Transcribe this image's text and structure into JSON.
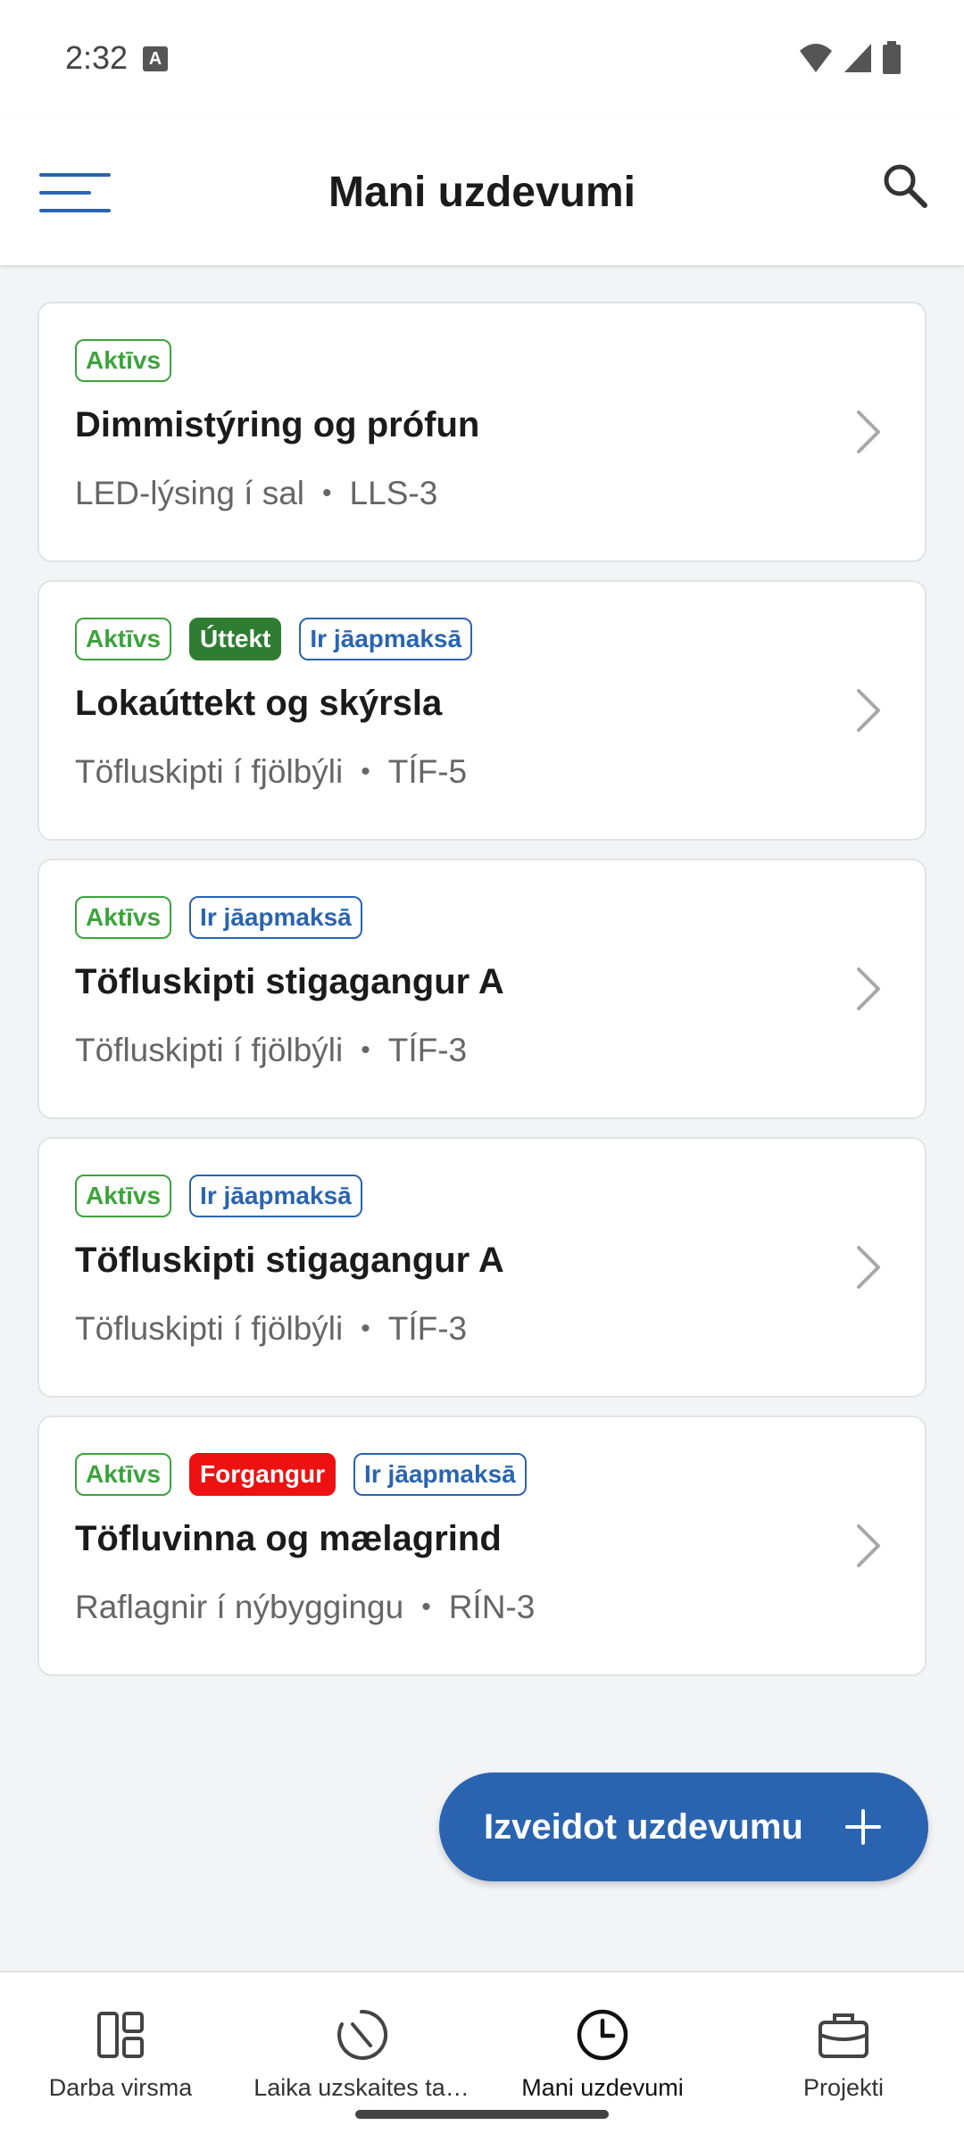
{
  "status_bar": {
    "time": "2:32",
    "notification_icon": "A"
  },
  "header": {
    "title": "Mani uzdevumi"
  },
  "tasks": [
    {
      "badges": [
        {
          "label": "Aktīvs",
          "kind": "active"
        }
      ],
      "title": "Dimmistýring og prófun",
      "project": "LED-lýsing í sal",
      "code": "LLS-3"
    },
    {
      "badges": [
        {
          "label": "Aktīvs",
          "kind": "active"
        },
        {
          "label": "Úttekt",
          "kind": "inspection"
        },
        {
          "label": "Ir jāapmaksā",
          "kind": "payment"
        }
      ],
      "title": "Lokaúttekt og skýrsla",
      "project": "Töfluskipti í fjölbýli",
      "code": "TÍF-5"
    },
    {
      "badges": [
        {
          "label": "Aktīvs",
          "kind": "active"
        },
        {
          "label": "Ir jāapmaksā",
          "kind": "payment"
        }
      ],
      "title": "Töfluskipti stigagangur A",
      "project": "Töfluskipti í fjölbýli",
      "code": "TÍF-3"
    },
    {
      "badges": [
        {
          "label": "Aktīvs",
          "kind": "active"
        },
        {
          "label": "Ir jāapmaksā",
          "kind": "payment"
        }
      ],
      "title": "Töfluskipti stigagangur A",
      "project": "Töfluskipti í fjölbýli",
      "code": "TÍF-3"
    },
    {
      "badges": [
        {
          "label": "Aktīvs",
          "kind": "active"
        },
        {
          "label": "Forgangur",
          "kind": "priority"
        },
        {
          "label": "Ir jāapmaksā",
          "kind": "payment"
        }
      ],
      "title": "Töfluvinna og mælagrind",
      "project": "Raflagnir í nýbyggingu",
      "code": "RÍN-3"
    }
  ],
  "separator": "•",
  "fab": {
    "label": "Izveidot uzdevumu",
    "icon": "plus-icon"
  },
  "bottom_nav": [
    {
      "label": "Darba virsma",
      "icon": "dashboard-icon",
      "active": false
    },
    {
      "label": "Laika uzskaites ta…",
      "icon": "timer-icon",
      "active": false
    },
    {
      "label": "Mani uzdevumi",
      "icon": "clock-icon",
      "active": true
    },
    {
      "label": "Projekti",
      "icon": "briefcase-icon",
      "active": false
    }
  ],
  "colors": {
    "primary": "#2a64b0",
    "active_badge": "#3ca33c",
    "inspection_badge": "#2e7d32",
    "priority_badge": "#ee1111"
  }
}
